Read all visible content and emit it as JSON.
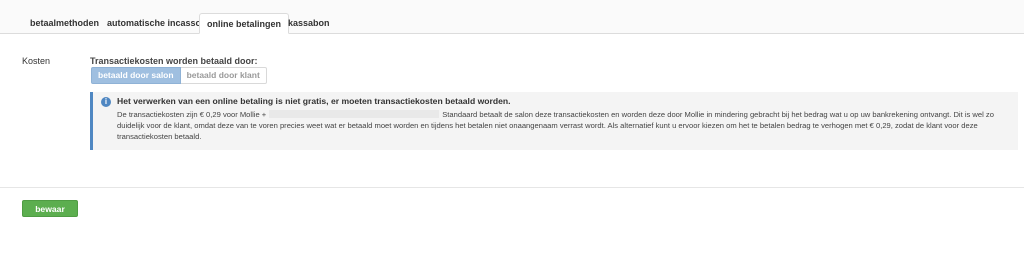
{
  "tabs": [
    {
      "label": "betaalmethoden",
      "active": false
    },
    {
      "label": "automatische incasso",
      "active": false
    },
    {
      "label": "online betalingen",
      "active": true
    },
    {
      "label": "kassabon",
      "active": false
    }
  ],
  "form": {
    "row_label": "Kosten",
    "field_title": "Transactiekosten worden betaald door:",
    "options": [
      {
        "label": "betaald door salon",
        "selected": true
      },
      {
        "label": "betaald door klant",
        "selected": false
      }
    ]
  },
  "info": {
    "icon": "info-icon",
    "title": "Het verwerken van een online betaling is niet gratis, er moeten transactiekosten betaald worden.",
    "body_part1": "De transactiekosten zijn € 0,29 voor Mollie +",
    "body_part2": "Standaard betaalt de salon deze transactiekosten en worden deze door Mollie in mindering gebracht bij het bedrag wat u op uw bankrekening ontvangt. Dit is wel zo duidelijk voor de klant, omdat deze van te voren precies weet wat er betaald moet worden en tijdens het betalen niet onaangenaam verrast wordt. Als alternatief kunt u ervoor kiezen om het te betalen bedrag te verhogen met € 0,29, zodat de klant voor deze transactiekosten betaald."
  },
  "footer": {
    "save_label": "bewaar"
  },
  "colors": {
    "accent_blue": "#4f87c2",
    "selected_option": "#9fbfe0",
    "save_green": "#5cae4f"
  }
}
